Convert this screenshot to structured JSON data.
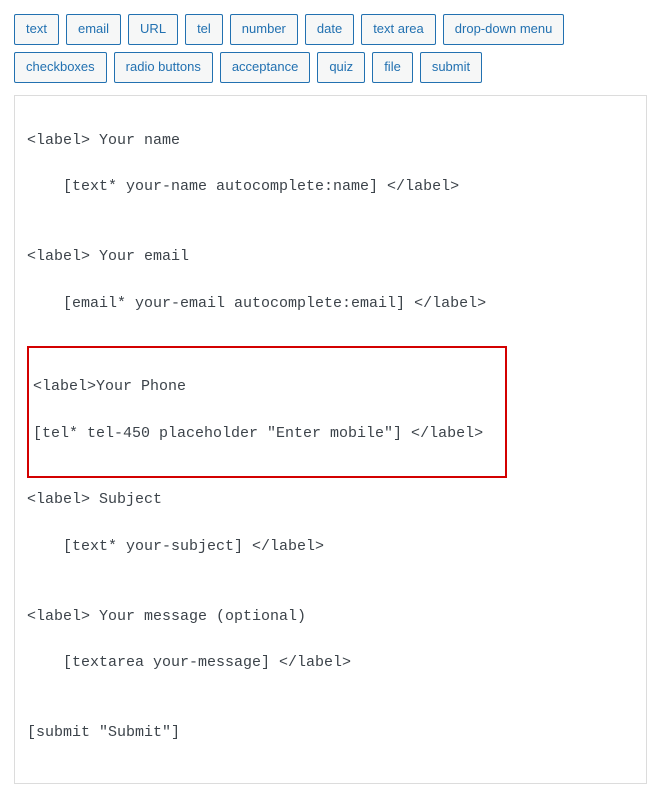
{
  "tags": {
    "row1": [
      "text",
      "email",
      "URL",
      "tel",
      "number",
      "date",
      "text area",
      "drop-down menu"
    ],
    "row2": [
      "checkboxes",
      "radio buttons",
      "acceptance",
      "quiz",
      "file",
      "submit"
    ]
  },
  "editor": {
    "line1": "<label> Your name",
    "line2": "    [text* your-name autocomplete:name] </label>",
    "blank": "",
    "line3": "<label> Your email",
    "line4": "    [email* your-email autocomplete:email] </label>",
    "hLine1": "<label>Your Phone",
    "hLine2": "[tel* tel-450 placeholder \"Enter mobile\"] </label>",
    "line5": "<label> Subject",
    "line6": "    [text* your-subject] </label>",
    "line7": "<label> Your message (optional)",
    "line8": "    [textarea your-message] </label>",
    "line9": "[submit \"Submit\"]"
  }
}
